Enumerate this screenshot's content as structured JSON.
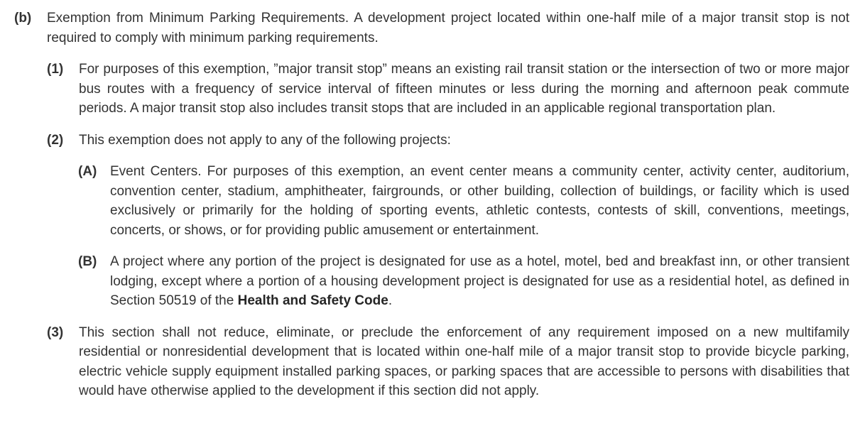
{
  "section_b": {
    "marker": "(b)",
    "text": "Exemption from Minimum Parking Requirements. A development project located within one-half mile of a major transit stop is not required to comply with minimum parking requirements."
  },
  "item_1": {
    "marker": "(1)",
    "text": "For purposes of this exemption, ”major transit stop” means an existing rail transit station or the intersection of two or more major bus routes with a frequency of service interval of fifteen minutes or less during the morning and afternoon peak commute periods. A major transit stop also includes transit stops that are included in an applicable regional transportation plan."
  },
  "item_2": {
    "marker": "(2)",
    "text": "This exemption does not apply to any of the following projects:"
  },
  "item_A": {
    "marker": "(A)",
    "text": "Event Centers. For purposes of this exemption, an event center means a community center, activity center, auditorium, convention center, stadium, amphitheater, fairgrounds, or other building, collection of buildings, or facility which is used exclusively or primarily for the holding of sporting events, athletic contests, contests of skill, conventions, meetings, concerts, or shows, or for providing public amusement or entertainment."
  },
  "item_B": {
    "marker": "(B)",
    "text_before": "A project where any portion of the project is designated for use as a hotel, motel, bed and breakfast inn, or other transient lodging, except where a portion of a housing development project is designated for use as a residential hotel, as defined in Section 50519 of the ",
    "text_bold": "Health and Safety Code",
    "text_after": "."
  },
  "item_3": {
    "marker": "(3)",
    "text": "This section shall not reduce, eliminate, or preclude the enforcement of any requirement imposed on a new multifamily residential or nonresidential development that is located within one-half mile of a major transit stop to provide bicycle parking, electric vehicle supply equipment installed parking spaces, or parking spaces that are accessible to persons with disabilities that would have otherwise applied to the development if this section did not apply."
  }
}
